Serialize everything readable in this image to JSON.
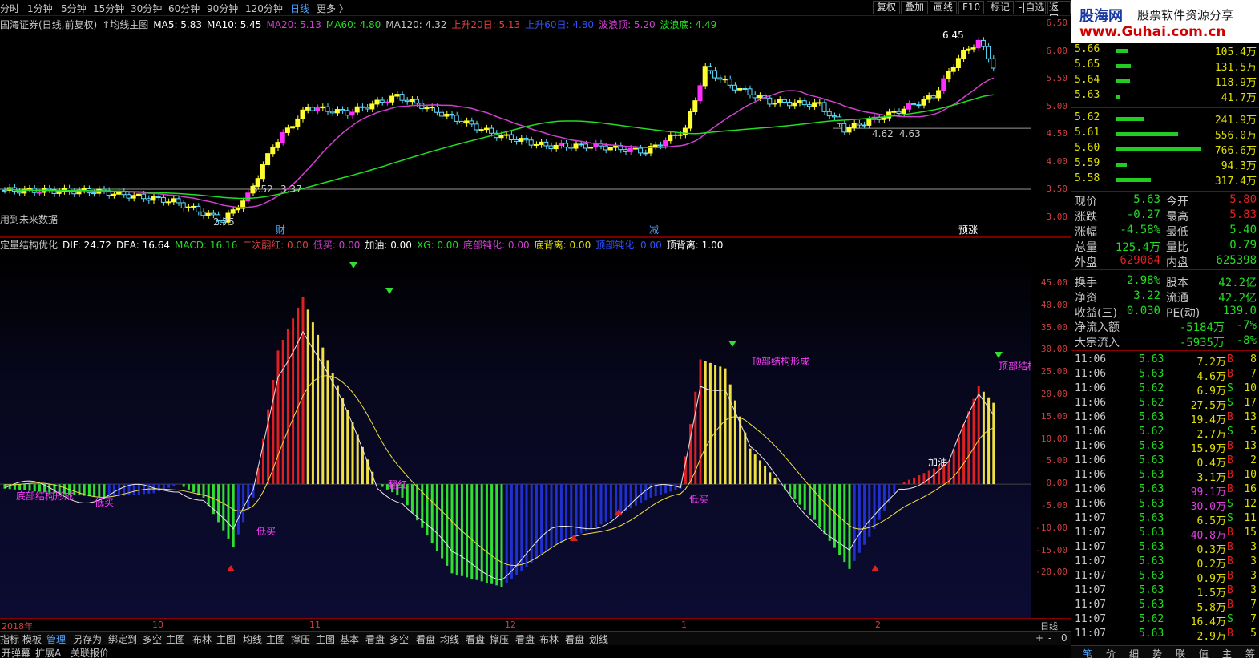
{
  "topbar": {
    "timeframes": [
      "分时",
      "1分钟",
      "5分钟",
      "15分钟",
      "30分钟",
      "60分钟",
      "90分钟",
      "120分钟",
      "日线",
      "更多 〉"
    ],
    "active": "日线",
    "right_buttons": [
      "复权",
      "叠加",
      "画线",
      "F10",
      "标记",
      "-|自选",
      "返回"
    ]
  },
  "kline": {
    "info": [
      {
        "t": "国海证券(日线,前复权)",
        "c": "#c8c8c8"
      },
      {
        "t": "↑均线主图",
        "c": "#c8c8c8"
      },
      {
        "t": "MA5: 5.83",
        "c": "#ffffff"
      },
      {
        "t": "MA10: 5.45",
        "c": "#ffffff"
      },
      {
        "t": "MA20: 5.13",
        "c": "#d040d0"
      },
      {
        "t": "MA60: 4.80",
        "c": "#22dd22"
      },
      {
        "t": "MA120: 4.32",
        "c": "#c8c8c8"
      },
      {
        "t": "上升20日: 5.13",
        "c": "#e04040"
      },
      {
        "t": "上升60日: 4.80",
        "c": "#3050ff"
      },
      {
        "t": "波浪顶: 5.20",
        "c": "#d040d0"
      },
      {
        "t": "波浪底: 4.49",
        "c": "#22dd22"
      }
    ],
    "yticks": [
      "6.50",
      "6.00",
      "5.50",
      "5.00",
      "4.50",
      "4.00",
      "3.50",
      "3.00"
    ],
    "annotations": {
      "high": "6.45",
      "l1": "3.52",
      "l2": "3.37",
      "l3": "2.75",
      "l4": "4.62",
      "l5": "4.63",
      "future": "用到未来数据",
      "m1": "财",
      "m2": "减",
      "m3": "预涨"
    }
  },
  "macd": {
    "info": [
      {
        "t": "定量结构优化",
        "c": "#c8c8c8"
      },
      {
        "t": "DIF: 24.72",
        "c": "#ffffff"
      },
      {
        "t": "DEA: 16.64",
        "c": "#ffffff"
      },
      {
        "t": "MACD: 16.16",
        "c": "#22dd22"
      },
      {
        "t": "二次翻红: 0.00",
        "c": "#e04040"
      },
      {
        "t": "低买: 0.00",
        "c": "#d040d0"
      },
      {
        "t": "加油: 0.00",
        "c": "#ffffff"
      },
      {
        "t": "XG: 0.00",
        "c": "#22dd22"
      },
      {
        "t": "底部钝化: 0.00",
        "c": "#d040d0"
      },
      {
        "t": "底背离: 0.00",
        "c": "#e0e000"
      },
      {
        "t": "顶部钝化: 0.00",
        "c": "#3050ff"
      },
      {
        "t": "顶背离: 1.00",
        "c": "#ffffff"
      }
    ],
    "yticks": [
      "45.00",
      "40.00",
      "35.00",
      "30.00",
      "25.00",
      "20.00",
      "15.00",
      "10.00",
      "5.00",
      "0.00",
      "-5.00",
      "-10.00",
      "-15.00",
      "-20.00"
    ],
    "labels": {
      "top1": "顶部结构形成",
      "top2": "顶部结构",
      "bottom": "底部结构形成",
      "buy": "低买",
      "oil": "加油",
      "flip": "翻红"
    }
  },
  "xaxis": {
    "labels": [
      "2018年",
      "10",
      "11",
      "12",
      "1",
      "2"
    ],
    "period": "日线"
  },
  "tabs": [
    "指标",
    "模板",
    "管理",
    "另存为",
    "绑定到",
    "多空",
    "主图",
    "布林",
    "主图",
    "均线",
    "主图",
    "撑压",
    "主图",
    "基本",
    "看盘",
    "多空",
    "看盘",
    "均线",
    "看盘",
    "撑压",
    "看盘",
    "布林",
    "看盘",
    "划线"
  ],
  "tab_controls": [
    "+",
    "-",
    "0"
  ],
  "bottom": [
    "开弹幕",
    "扩展A",
    "关联报价"
  ],
  "right": {
    "logo": {
      "name": "股海网",
      "slogan": "股票软件资源分享",
      "url": "www.Guhai.com.cn"
    },
    "orderbook": [
      {
        "p": "5.66",
        "v": "105.4万",
        "w": 0.14
      },
      {
        "p": "5.65",
        "v": "131.5万",
        "w": 0.17
      },
      {
        "p": "5.64",
        "v": "118.9万",
        "w": 0.16
      },
      {
        "p": "5.63",
        "v": "41.7万",
        "w": 0.05
      },
      {
        "p": "5.62",
        "v": "241.9万",
        "w": 0.32
      },
      {
        "p": "5.61",
        "v": "556.0万",
        "w": 0.73
      },
      {
        "p": "5.60",
        "v": "766.6万",
        "w": 1.0
      },
      {
        "p": "5.59",
        "v": "94.3万",
        "w": 0.12
      },
      {
        "p": "5.58",
        "v": "317.4万",
        "w": 0.41
      }
    ],
    "quote": [
      {
        "a": "现价",
        "b": "5.63",
        "c": "今开",
        "d": "5.80"
      },
      {
        "a": "涨跌",
        "b": "-0.27",
        "c": "最高",
        "d": "5.83"
      },
      {
        "a": "涨幅",
        "b": "-4.58%",
        "c": "最低",
        "d": "5.40"
      },
      {
        "a": "总量",
        "b": "125.4万",
        "c": "量比",
        "d": "0.79"
      },
      {
        "a": "外盘",
        "b": "629064",
        "c": "内盘",
        "d": "625398"
      },
      {
        "a": "换手",
        "b": "2.98%",
        "c": "股本",
        "d": "42.2亿"
      },
      {
        "a": "净资",
        "b": "3.22",
        "c": "流通",
        "d": "42.2亿"
      },
      {
        "a": "收益(三)",
        "b": "0.030",
        "c": "PE(动)",
        "d": "139.0"
      }
    ],
    "flow": [
      {
        "a": "净流入额",
        "b": "-5184万",
        "d": "-7%"
      },
      {
        "a": "大宗流入",
        "b": "-5935万",
        "d": "-8%"
      }
    ],
    "ticks": [
      {
        "t": "11:06",
        "p": "5.63",
        "v": "7.2万",
        "s": "B",
        "n": "8"
      },
      {
        "t": "11:06",
        "p": "5.63",
        "v": "4.6万",
        "s": "B",
        "n": "7"
      },
      {
        "t": "11:06",
        "p": "5.62",
        "v": "6.9万",
        "s": "S",
        "n": "10"
      },
      {
        "t": "11:06",
        "p": "5.62",
        "v": "27.5万",
        "s": "S",
        "n": "17"
      },
      {
        "t": "11:06",
        "p": "5.63",
        "v": "19.4万",
        "s": "B",
        "n": "13"
      },
      {
        "t": "11:06",
        "p": "5.62",
        "v": "2.7万",
        "s": "S",
        "n": "5"
      },
      {
        "t": "11:06",
        "p": "5.63",
        "v": "15.9万",
        "s": "B",
        "n": "13"
      },
      {
        "t": "11:06",
        "p": "5.63",
        "v": "0.4万",
        "s": "B",
        "n": "2"
      },
      {
        "t": "11:06",
        "p": "5.63",
        "v": "3.1万",
        "s": "B",
        "n": "10"
      },
      {
        "t": "11:06",
        "p": "5.63",
        "v": "99.1万",
        "s": "B",
        "n": "16"
      },
      {
        "t": "11:06",
        "p": "5.63",
        "v": "30.0万",
        "s": "S",
        "n": "12"
      },
      {
        "t": "11:07",
        "p": "5.63",
        "v": "6.5万",
        "s": "S",
        "n": "11"
      },
      {
        "t": "11:07",
        "p": "5.63",
        "v": "40.8万",
        "s": "B",
        "n": "15"
      },
      {
        "t": "11:07",
        "p": "5.63",
        "v": "0.3万",
        "s": "B",
        "n": "3"
      },
      {
        "t": "11:07",
        "p": "5.63",
        "v": "0.2万",
        "s": "B",
        "n": "3"
      },
      {
        "t": "11:07",
        "p": "5.63",
        "v": "0.9万",
        "s": "B",
        "n": "3"
      },
      {
        "t": "11:07",
        "p": "5.63",
        "v": "1.5万",
        "s": "B",
        "n": "3"
      },
      {
        "t": "11:07",
        "p": "5.63",
        "v": "5.8万",
        "s": "B",
        "n": "7"
      },
      {
        "t": "11:07",
        "p": "5.62",
        "v": "16.4万",
        "s": "S",
        "n": "7"
      },
      {
        "t": "11:07",
        "p": "5.63",
        "v": "2.9万",
        "s": "B",
        "n": "5"
      }
    ],
    "tabs": [
      "笔",
      "价",
      "细",
      "势",
      "联",
      "值",
      "主",
      "筹"
    ]
  }
}
